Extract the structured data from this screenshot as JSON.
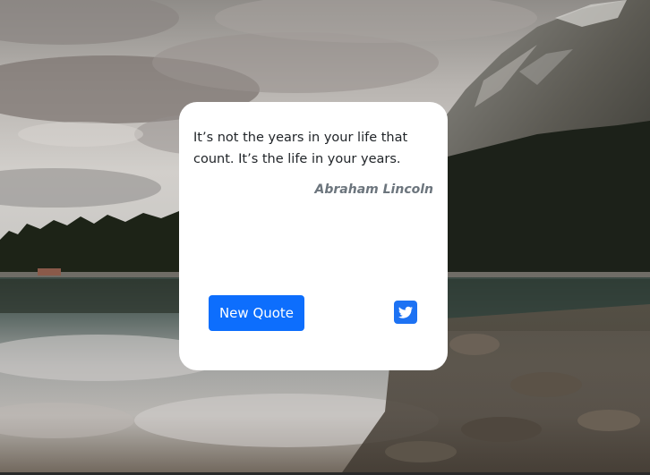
{
  "quote": {
    "text": "It’s not the years in your life that count. It’s the life in your years.",
    "author": "Abraham Lincoln"
  },
  "actions": {
    "new_quote_label": "New Quote",
    "tweet_icon": "twitter-icon"
  },
  "colors": {
    "card_background": "#ffffff",
    "button_primary": "#0d6efd",
    "twitter_icon": "#1d72f3",
    "quote_text": "#212529",
    "author_text": "#6c757d"
  }
}
